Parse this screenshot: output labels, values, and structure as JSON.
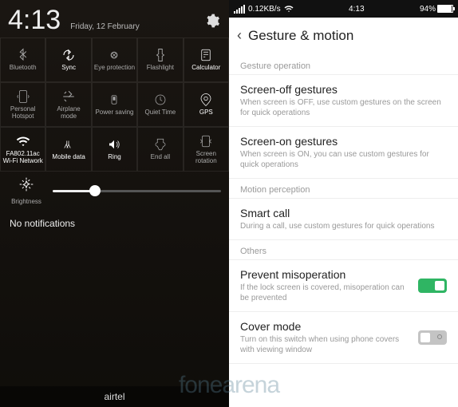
{
  "left": {
    "clock": "4:13",
    "date": "Friday, 12 February",
    "tiles": [
      {
        "label": "Bluetooth",
        "on": false
      },
      {
        "label": "Sync",
        "on": true
      },
      {
        "label": "Eye protection",
        "on": false
      },
      {
        "label": "Flashlight",
        "on": false
      },
      {
        "label": "Calculator",
        "on": true
      },
      {
        "label": "Personal Hotspot",
        "on": false
      },
      {
        "label": "Airplane mode",
        "on": false
      },
      {
        "label": "Power saving",
        "on": false
      },
      {
        "label": "Quiet Time",
        "on": false
      },
      {
        "label": "GPS",
        "on": true
      },
      {
        "label": "FA802.11ac Wi-Fi Network",
        "on": true
      },
      {
        "label": "Mobile data",
        "on": true
      },
      {
        "label": "Ring",
        "on": true
      },
      {
        "label": "End all",
        "on": false
      },
      {
        "label": "Screen rotation",
        "on": false
      }
    ],
    "brightness": {
      "label": "Brightness",
      "value": 25
    },
    "notifications": "No notifications",
    "carrier": "airtel"
  },
  "right": {
    "statusbar": {
      "speed": "0.12KB/s",
      "clock": "4:13",
      "battery": "94%"
    },
    "title": "Gesture & motion",
    "sections": [
      {
        "header": "Gesture operation",
        "items": [
          {
            "title": "Screen-off gestures",
            "sub": "When screen is OFF, use custom gestures on the screen for quick operations"
          },
          {
            "title": "Screen-on gestures",
            "sub": "When screen is ON, you can use custom gestures for quick operations"
          }
        ]
      },
      {
        "header": "Motion perception",
        "items": [
          {
            "title": "Smart call",
            "sub": "During a call, use custom gestures for quick operations"
          }
        ]
      },
      {
        "header": "Others",
        "items": [
          {
            "title": "Prevent misoperation",
            "sub": "If the lock screen is covered, misoperation can be prevented",
            "toggle": true,
            "on": true
          },
          {
            "title": "Cover mode",
            "sub": "Turn on this switch when using phone covers with viewing window",
            "toggle": true,
            "on": false
          }
        ]
      }
    ]
  },
  "watermark": "fonearena"
}
